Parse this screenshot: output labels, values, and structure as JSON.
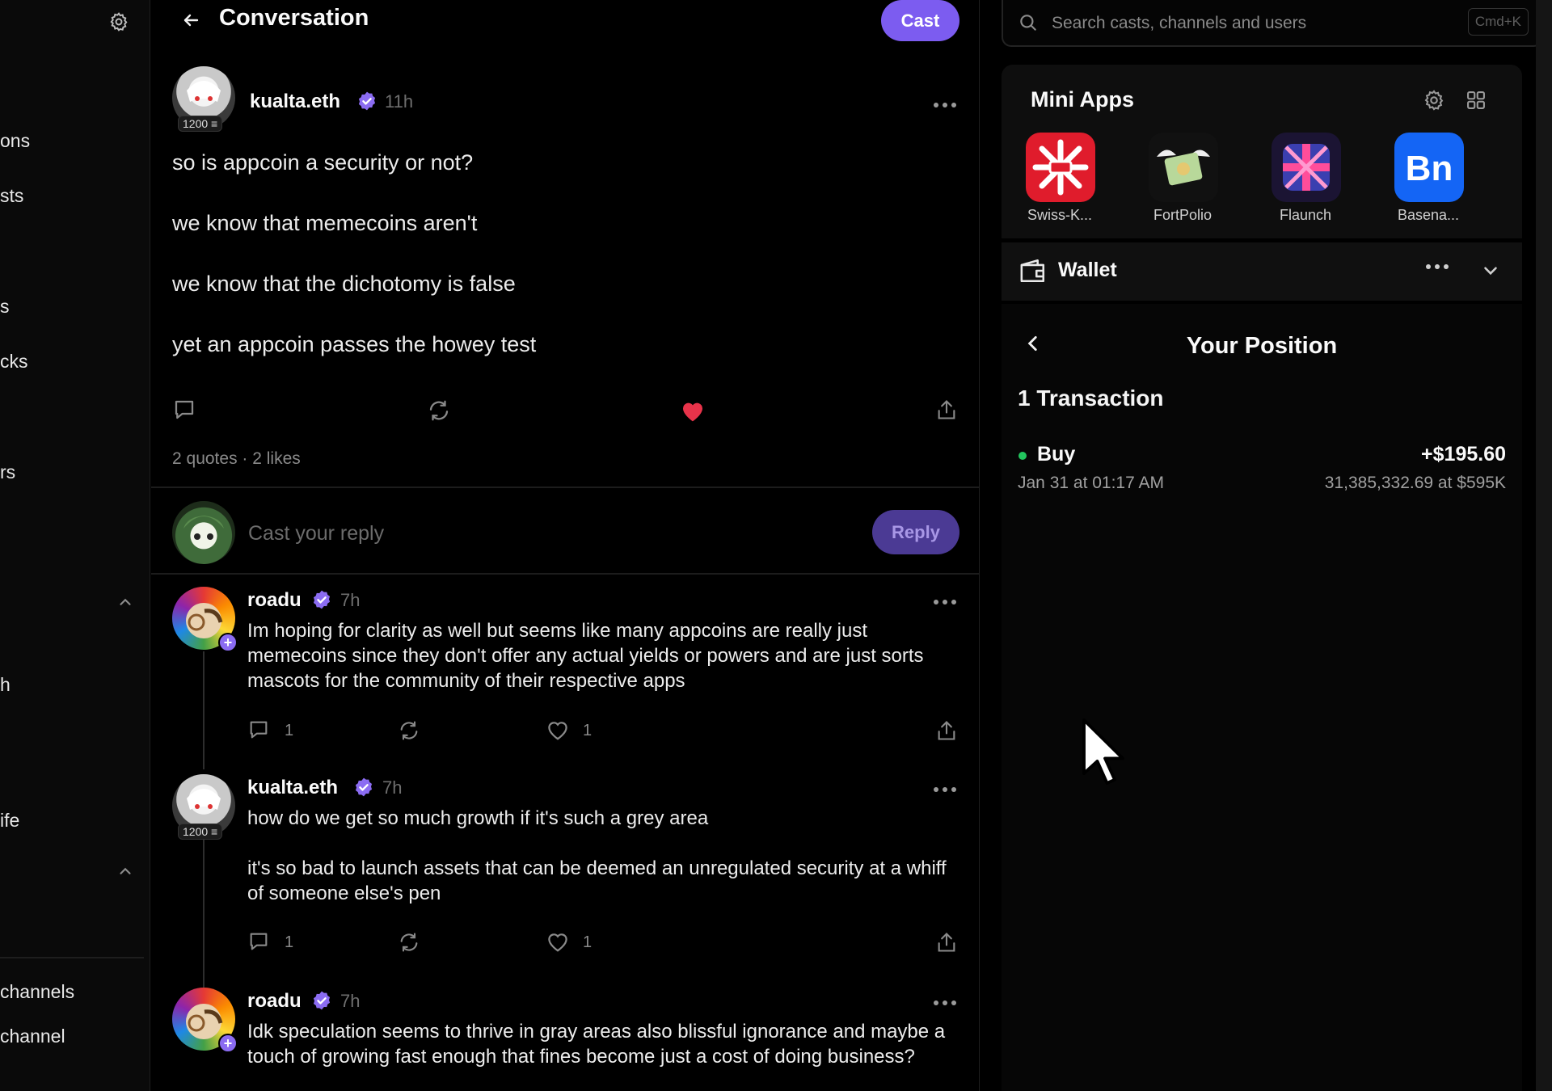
{
  "sidebar": {
    "items": [
      {
        "label": "ons"
      },
      {
        "label": "sts"
      },
      {
        "label": "s"
      },
      {
        "label": "cks"
      },
      {
        "label": "rs"
      },
      {
        "label": "h"
      },
      {
        "label": "ife"
      },
      {
        "label": "channels"
      },
      {
        "label": "channel"
      }
    ]
  },
  "header": {
    "title": "Conversation",
    "cast_label": "Cast"
  },
  "main_cast": {
    "author": "kualta.eth",
    "badge": "1200",
    "time": "11h",
    "lines": [
      "so is appcoin a security or not?",
      "we know that memecoins aren't",
      "we know that the dichotomy is false",
      "yet an appcoin passes the howey test"
    ],
    "liked": true,
    "like_color": "#e8334a",
    "stats": "2 quotes · 2 likes"
  },
  "reply_box": {
    "placeholder": "Cast your reply",
    "button_label": "Reply"
  },
  "replies": [
    {
      "author": "roadu",
      "time": "7h",
      "text": "Im hoping for clarity as well but seems like many appcoins are really just memecoins since they don't offer any actual yields or powers and are just sorts mascots for the community of their respective apps",
      "replies_count": "1",
      "likes_count": "1"
    },
    {
      "author": "kualta.eth",
      "badge": "1200",
      "time": "7h",
      "text1": "how do we get so much growth if it's such a grey area",
      "text2": "it's so bad to launch assets that can be deemed an unregulated security at a whiff of someone else's pen",
      "replies_count": "1",
      "likes_count": "1"
    },
    {
      "author": "roadu",
      "time": "7h",
      "text": "Idk speculation seems to thrive in gray areas also blissful ignorance and maybe a touch of growing fast enough that fines become just a cost of doing business?"
    }
  ],
  "search": {
    "placeholder": "Search casts, channels and users",
    "shortcut": "Cmd+K"
  },
  "mini_apps": {
    "title": "Mini Apps",
    "apps": [
      {
        "label": "Swiss-K...",
        "icon": "swiss-knife-icon"
      },
      {
        "label": "FortPolio",
        "icon": "money-wings-icon"
      },
      {
        "label": "Flaunch",
        "icon": "flaunch-flag-icon"
      },
      {
        "label": "Basena...",
        "icon": "bn-icon"
      }
    ]
  },
  "wallet": {
    "label": "Wallet"
  },
  "position": {
    "title": "Your Position",
    "tx_count": "1 Transaction",
    "transactions": [
      {
        "type": "Buy",
        "amount": "+$195.60",
        "date": "Jan 31 at 01:17 AM",
        "detail": "31,385,332.69 at $595K",
        "status_color": "#22c55e"
      }
    ]
  },
  "colors": {
    "accent": "#7c5cf0",
    "verified": "#8b6cf2",
    "like": "#e8334a"
  }
}
